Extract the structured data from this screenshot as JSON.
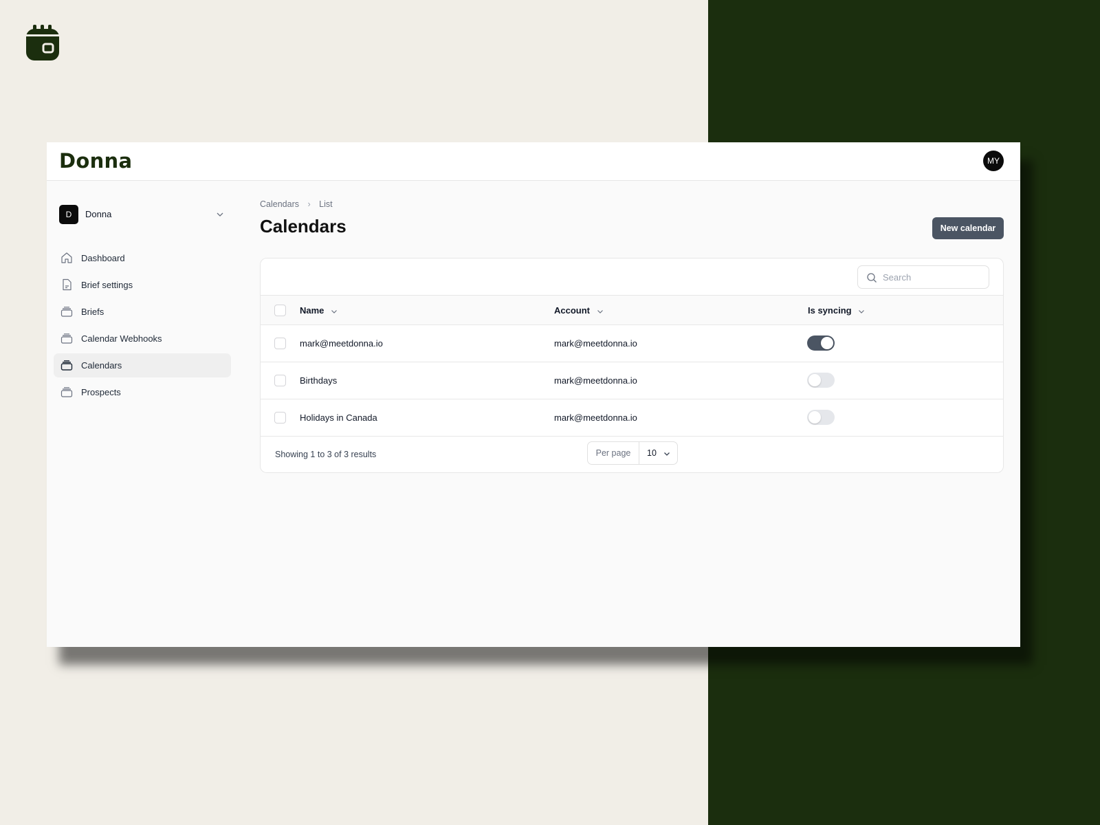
{
  "app": {
    "logo_text": "Donna",
    "avatar_initials": "MY"
  },
  "team": {
    "badge": "D",
    "name": "Donna"
  },
  "sidebar": {
    "items": [
      {
        "label": "Dashboard",
        "icon": "home-icon"
      },
      {
        "label": "Brief settings",
        "icon": "document-icon"
      },
      {
        "label": "Briefs",
        "icon": "collection-icon"
      },
      {
        "label": "Calendar Webhooks",
        "icon": "collection-icon"
      },
      {
        "label": "Calendars",
        "icon": "collection-icon",
        "active": true
      },
      {
        "label": "Prospects",
        "icon": "collection-icon"
      }
    ]
  },
  "breadcrumb": {
    "items": [
      "Calendars",
      "List"
    ]
  },
  "page": {
    "title": "Calendars",
    "new_button": "New calendar"
  },
  "search": {
    "placeholder": "Search"
  },
  "table": {
    "columns": [
      "Name",
      "Account",
      "Is syncing"
    ],
    "rows": [
      {
        "name": "mark@meetdonna.io",
        "account": "mark@meetdonna.io",
        "syncing": true
      },
      {
        "name": "Birthdays",
        "account": "mark@meetdonna.io",
        "syncing": false
      },
      {
        "name": "Holidays in Canada",
        "account": "mark@meetdonna.io",
        "syncing": false
      }
    ]
  },
  "pagination": {
    "summary": "Showing 1 to 3 of 3 results",
    "per_page_label": "Per page",
    "per_page_value": "10"
  },
  "colors": {
    "brand_dark": "#1b2e0e",
    "background_light": "#f1eee7",
    "button": "#4b5563",
    "toggle_on": "#4b5563"
  }
}
